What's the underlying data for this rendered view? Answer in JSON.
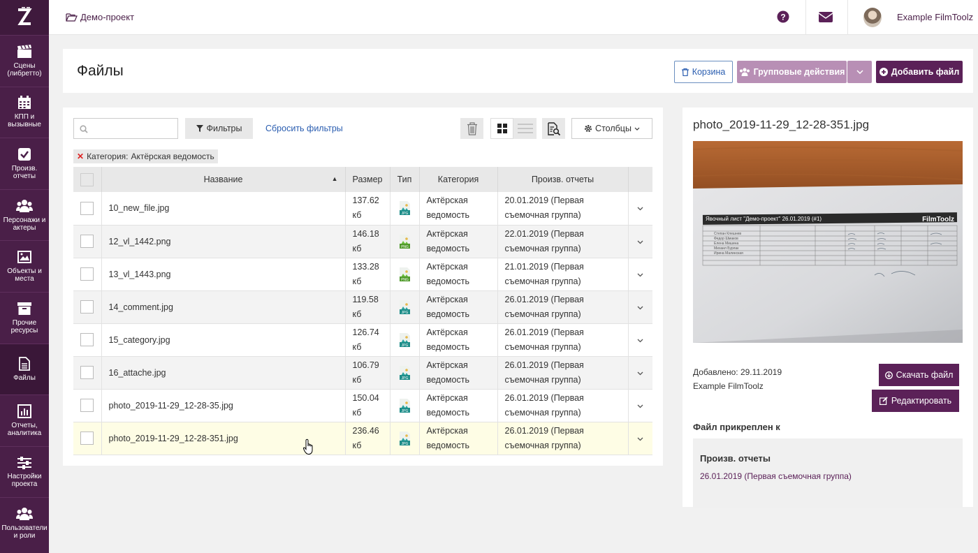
{
  "sidebar": {
    "items": [
      {
        "label": "Сцены (либретто)",
        "icon": "clapperboard-icon"
      },
      {
        "label": "КПП и вызывные",
        "icon": "calendar-icon"
      },
      {
        "label": "Произв. отчеты",
        "icon": "checkbox-icon"
      },
      {
        "label": "Персонажи и актеры",
        "icon": "people-icon"
      },
      {
        "label": "Объекты и места",
        "icon": "picture-icon"
      },
      {
        "label": "Прочие ресурсы",
        "icon": "archive-icon"
      },
      {
        "label": "Файлы",
        "icon": "file-icon"
      },
      {
        "label": "Отчеты, аналитика",
        "icon": "bar-chart-icon"
      },
      {
        "label": "Настройки проекта",
        "icon": "sliders-icon"
      },
      {
        "label": "Пользователи и роли",
        "icon": "users-icon"
      }
    ],
    "active": "Файлы"
  },
  "topbar": {
    "breadcrumb": "Демо-проект",
    "username": "Example FilmToolz"
  },
  "header": {
    "title": "Файлы",
    "trash_label": "Корзина",
    "group_label": "Групповые действия",
    "add_label": "Добавить файл"
  },
  "toolbar": {
    "search_placeholder": "",
    "filters_label": "Фильтры",
    "reset_label": "Сбросить фильтры",
    "columns_label": "Столбцы"
  },
  "filter_chip": {
    "key": "Категория:",
    "value": "Актёрская ведомость"
  },
  "table": {
    "headers": [
      "Название",
      "Размер",
      "Тип",
      "Категория",
      "Произв. отчеты"
    ],
    "rows": [
      {
        "name": "10_new_file.jpg",
        "size1": "137.62",
        "size2": "кб",
        "type": "JPG",
        "cat1": "Актёрская",
        "cat2": "ведомость",
        "rep1": "20.01.2019 (Первая",
        "rep2": "съемочная группа)"
      },
      {
        "name": "12_vl_1442.png",
        "size1": "146.18",
        "size2": "кб",
        "type": "PNG",
        "cat1": "Актёрская",
        "cat2": "ведомость",
        "rep1": "22.01.2019 (Первая",
        "rep2": "съемочная группа)"
      },
      {
        "name": "13_vl_1443.png",
        "size1": "133.28",
        "size2": "кб",
        "type": "PNG",
        "cat1": "Актёрская",
        "cat2": "ведомость",
        "rep1": "21.01.2019 (Первая",
        "rep2": "съемочная группа)"
      },
      {
        "name": "14_comment.jpg",
        "size1": "119.58",
        "size2": "кб",
        "type": "JPG",
        "cat1": "Актёрская",
        "cat2": "ведомость",
        "rep1": "26.01.2019 (Первая",
        "rep2": "съемочная группа)"
      },
      {
        "name": "15_category.jpg",
        "size1": "126.74",
        "size2": "кб",
        "type": "JPG",
        "cat1": "Актёрская",
        "cat2": "ведомость",
        "rep1": "26.01.2019 (Первая",
        "rep2": "съемочная группа)"
      },
      {
        "name": "16_attache.jpg",
        "size1": "106.79",
        "size2": "кб",
        "type": "JPG",
        "cat1": "Актёрская",
        "cat2": "ведомость",
        "rep1": "26.01.2019 (Первая",
        "rep2": "съемочная группа)"
      },
      {
        "name": "photo_2019-11-29_12-28-35.jpg",
        "size1": "150.04",
        "size2": "кб",
        "type": "JPG",
        "cat1": "Актёрская",
        "cat2": "ведомость",
        "rep1": "26.01.2019 (Первая",
        "rep2": "съемочная группа)"
      },
      {
        "name": "photo_2019-11-29_12-28-351.jpg",
        "size1": "236.46",
        "size2": "кб",
        "type": "JPG",
        "cat1": "Актёрская",
        "cat2": "ведомость",
        "rep1": "26.01.2019 (Первая",
        "rep2": "съемочная группа)"
      }
    ]
  },
  "detail": {
    "title": "photo_2019-11-29_12-28-351.jpg",
    "photo_heading": "Явочный лист \"Демо-проект\" 26.01.2019 (#1)",
    "photo_brand": "FilmToolz",
    "added": "Добавлено: 29.11.2019",
    "author": "Example FilmToolz",
    "download_label": "Скачать файл",
    "edit_label": "Редактировать",
    "attached_heading": "Файл прикреплен к",
    "attached_section": "Произв. отчеты",
    "attached_link": "26.01.2019 (Первая съемочная группа)"
  },
  "colors": {
    "sidebar": "#4a1f48",
    "accent": "#5b2158",
    "accent_light": "#b88fb5",
    "link": "#2a5db0",
    "selected_row": "#fefde5"
  }
}
